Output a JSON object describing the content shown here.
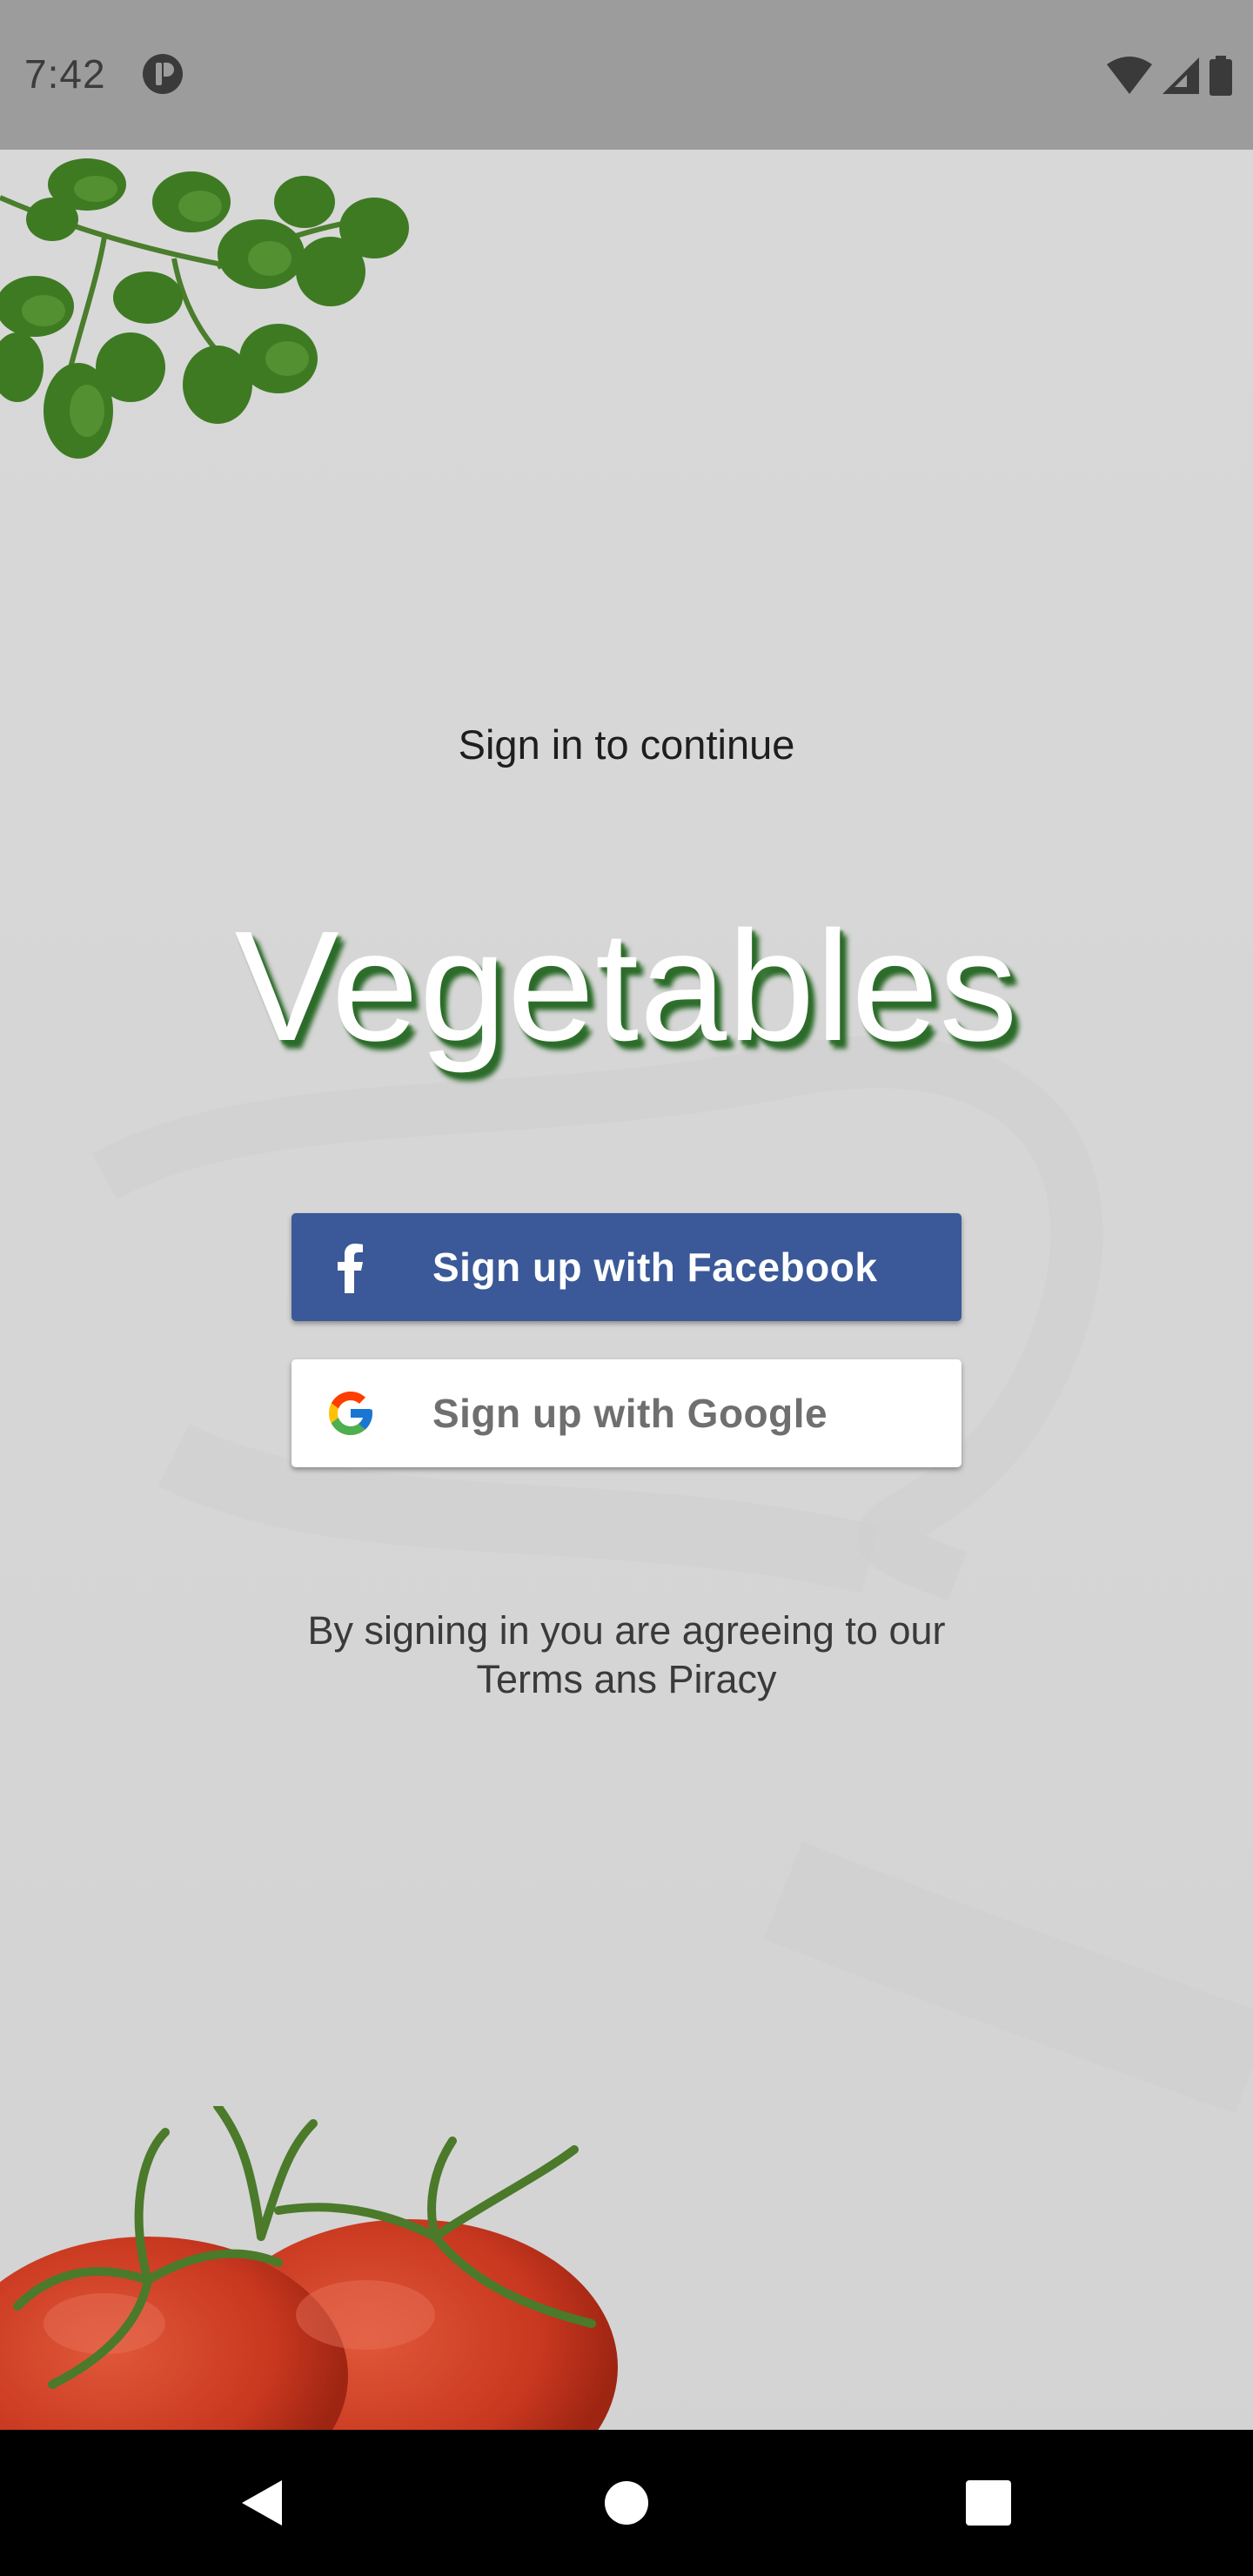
{
  "status_bar": {
    "time": "7:42",
    "icons": [
      "app-notification-icon",
      "wifi-icon",
      "signal-icon",
      "battery-icon"
    ]
  },
  "main": {
    "caption": "Sign in to continue",
    "title": "Vegetables",
    "facebook_button": {
      "label": "Sign up with Facebook",
      "icon": "facebook-icon",
      "color": "#3b5998"
    },
    "google_button": {
      "label": "Sign up with Google",
      "icon": "google-icon",
      "color": "#ffffff"
    },
    "terms_line1": "By signing in you are agreeing to our",
    "terms_line2": "Terms ans Piracy"
  },
  "decorations": [
    "coriander-leaves",
    "tomatoes"
  ],
  "nav_bar": {
    "buttons": [
      "back-icon",
      "home-icon",
      "recents-icon"
    ]
  },
  "colors": {
    "title_shadow": "#2c6b2a",
    "background": "#d8d8d8",
    "status_bar": "#9c9c9c"
  }
}
